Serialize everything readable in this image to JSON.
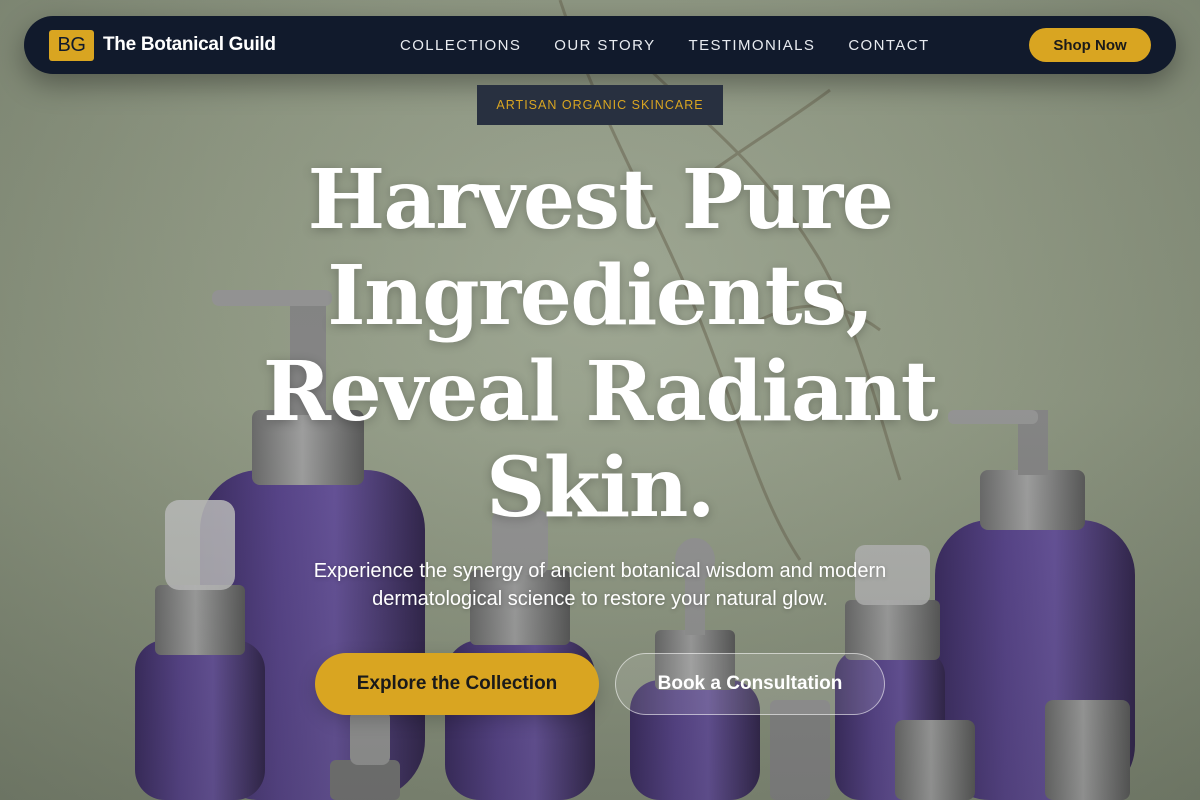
{
  "brand": {
    "mark": "BG",
    "name": "The Botanical Guild"
  },
  "nav": {
    "links": [
      "COLLECTIONS",
      "OUR STORY",
      "TESTIMONIALS",
      "CONTACT"
    ],
    "cta": "Shop Now"
  },
  "hero": {
    "badge": "ARTISAN ORGANIC SKINCARE",
    "headline_lines": [
      "Harvest Pure",
      "Ingredients,",
      "Reveal Radiant",
      "Skin."
    ],
    "subtext_lines": [
      "Experience the synergy of ancient botanical wisdom and modern",
      "dermatological science to restore your natural glow."
    ],
    "primary_button": "Explore the Collection",
    "secondary_button": "Book a Consultation"
  },
  "colors": {
    "accent": "#d9a521",
    "nav_background": "#111a2c",
    "badge_background": "#283040",
    "bottle_purple": "#4e3a7c",
    "background_sage": "#969f89"
  },
  "background_image": "purple-skincare-bottles-photo"
}
